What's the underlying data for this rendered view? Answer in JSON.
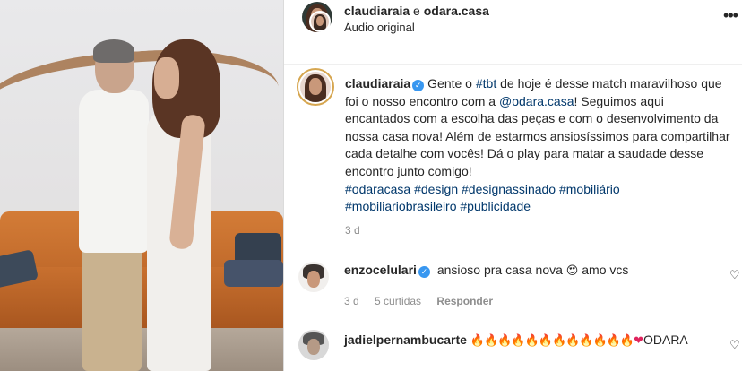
{
  "post": {
    "header": {
      "user1": "claudiaraia",
      "conjunction": "e",
      "user2": "odara.casa",
      "audio": "Áudio original",
      "more_label": "•••"
    },
    "caption": {
      "username": "claudiaraia",
      "text_1": "Gente o ",
      "tag_tbt": "#tbt",
      "text_2": " de hoje é desse match maravilhoso que foi o nosso encontro com a ",
      "mention": "@odara.casa",
      "text_3": "! Seguimos aqui encantados com a escolha das peças e com o desenvolvimento da nossa casa nova! Além de estarmos ansiosíssimos para compartilhar cada detalhe com vocês! Dá o play para matar a saudade desse encontro junto comigo!",
      "hashtags": [
        "#odaracasa",
        "#design",
        "#designassinado",
        "#mobiliário",
        "#mobiliariobrasileiro",
        "#publicidade"
      ],
      "time": "3 d"
    },
    "comments": [
      {
        "username": "enzocelulari",
        "verified": true,
        "text_1": "ansioso pra casa nova ",
        "emoji": "😍",
        "text_2": "amo vcs",
        "time": "3 d",
        "likes": "5 curtidas",
        "reply_label": "Responder"
      },
      {
        "username": "jadielpernambucarte",
        "fires": "🔥🔥🔥🔥🔥🔥🔥🔥🔥🔥🔥🔥",
        "heart": "❤",
        "text": "ODARA"
      }
    ]
  },
  "colors": {
    "link": "#00376b",
    "verified": "#3897f0",
    "muted": "#8e8e8e",
    "text": "#262626"
  },
  "icons": {
    "verified": "verified-badge-icon",
    "like": "heart-outline-icon",
    "more": "more-horizontal-icon"
  }
}
